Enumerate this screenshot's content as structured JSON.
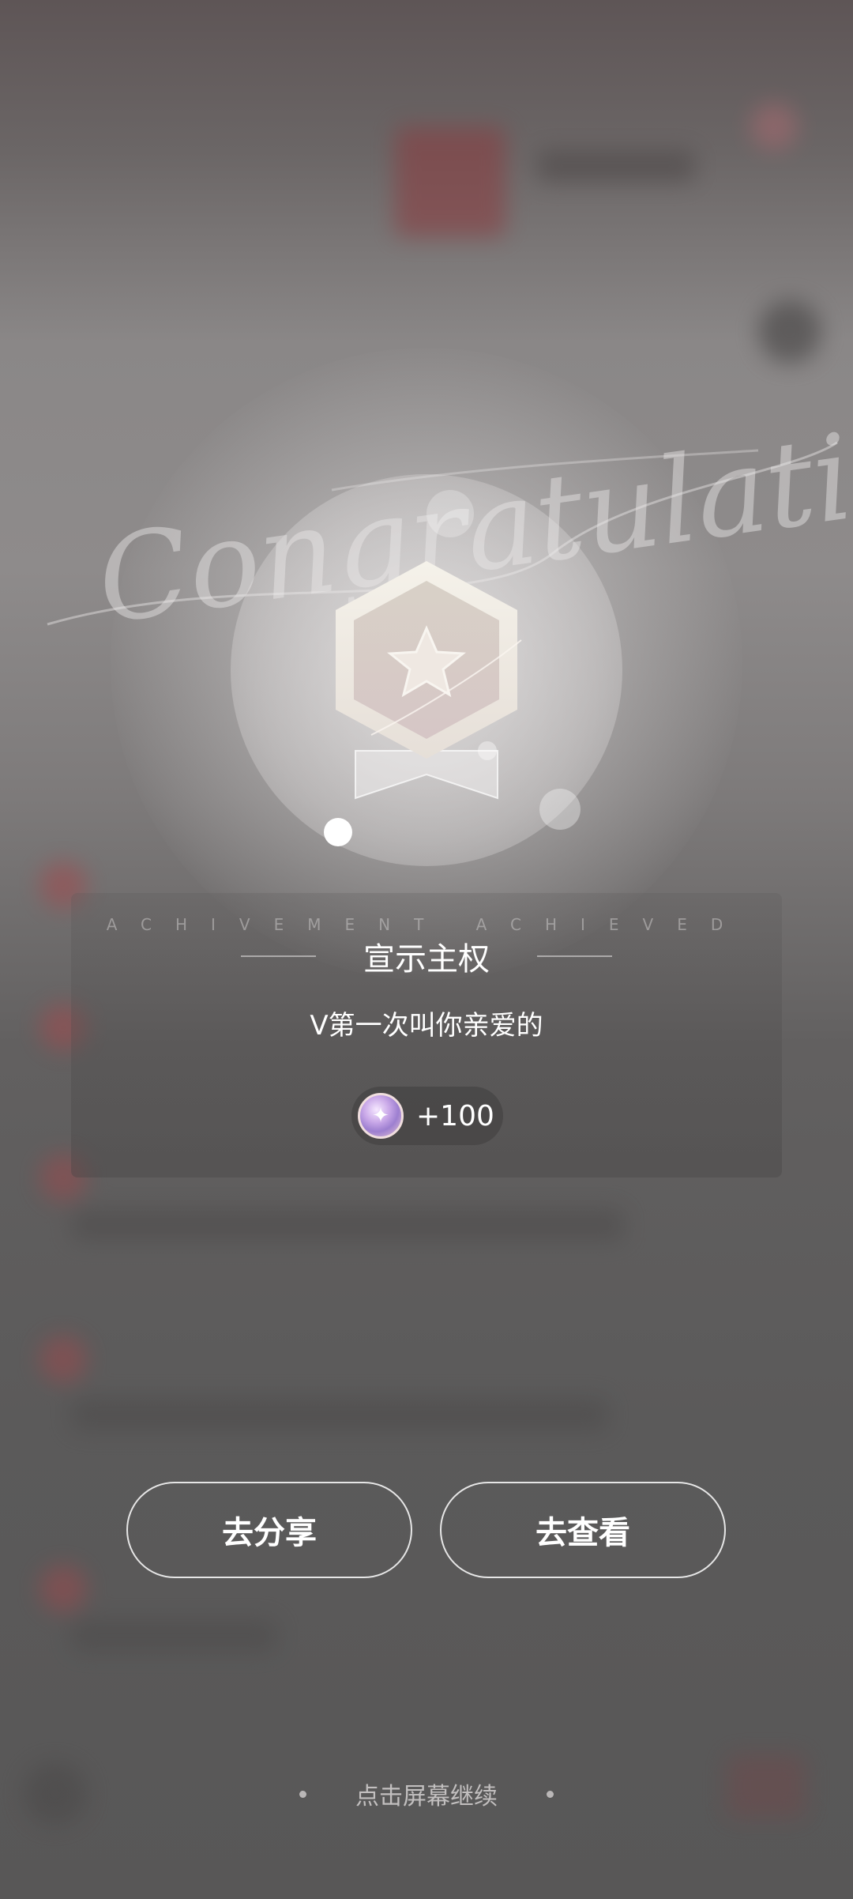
{
  "achievement": {
    "script_text": "Congratulations",
    "strip_text": "ACHIVEMENT  ACHIEVED",
    "title": "宣示主权",
    "description": "V第一次叫你亲爱的",
    "reward": {
      "icon": "gem-icon",
      "amount": "+100"
    }
  },
  "actions": {
    "share_label": "去分享",
    "view_label": "去查看"
  },
  "footer": {
    "continue_label": "点击屏幕继续"
  },
  "colors": {
    "overlay": "#5b5a5a",
    "text": "#ffffff",
    "button_border": "#ffffff"
  }
}
